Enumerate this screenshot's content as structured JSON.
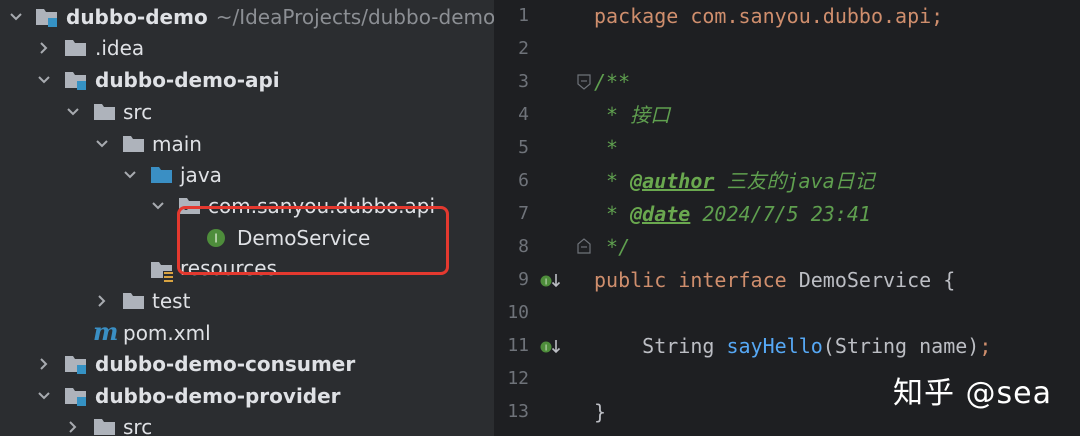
{
  "tree": {
    "root": {
      "name": "dubbo-demo",
      "path": "~/IdeaProjects/dubbo-demo"
    },
    "idea": ".idea",
    "api_module": "dubbo-demo-api",
    "src": "src",
    "main": "main",
    "java": "java",
    "package": "com.sanyou.dubbo.api",
    "demo_service": "DemoService",
    "resources": "resources",
    "test": "test",
    "pom": "pom.xml",
    "consumer_module": "dubbo-demo-consumer",
    "provider_module": "dubbo-demo-provider",
    "provider_src": "src"
  },
  "editor": {
    "line_numbers": [
      "1",
      "2",
      "3",
      "4",
      "5",
      "6",
      "7",
      "8",
      "9",
      "10",
      "11",
      "12",
      "13"
    ],
    "l1_kw": "package",
    "l1_rest": " com.sanyou.dubbo.api;",
    "l3": "/**",
    "l4": " * 接口",
    "l5": " *",
    "l6_star": " * ",
    "l6_tag": "@author",
    "l6_text": " 三友的java日记",
    "l7_star": " * ",
    "l7_tag": "@date",
    "l7_text": " 2024/7/5 23:41",
    "l8": " */",
    "l9_kw1": "public",
    "l9_kw2": "interface",
    "l9_name": " DemoService {",
    "l11_type": "    String ",
    "l11_fn": "sayHello",
    "l11_args": "(String name)",
    "l11_semi": ";",
    "l13": "}"
  },
  "watermark": "知乎 @sea"
}
